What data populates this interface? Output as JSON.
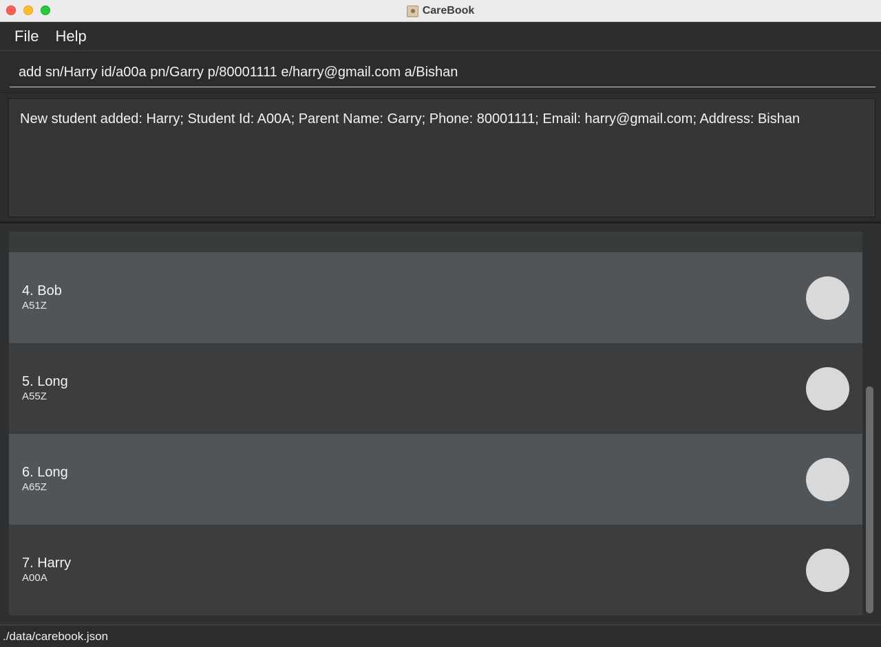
{
  "window": {
    "title": "CareBook"
  },
  "menu": {
    "items": [
      "File",
      "Help"
    ]
  },
  "command": {
    "value": "add sn/Harry id/a00a pn/Garry p/80001111 e/harry@gmail.com a/Bishan"
  },
  "result": {
    "text": "New student added: Harry; Student Id: A00A; Parent Name: Garry; Phone: 80001111; Email: harry@gmail.com; Address: Bishan"
  },
  "students": [
    {
      "title": "4. Bob",
      "id": "A51Z"
    },
    {
      "title": "5. Long",
      "id": "A55Z"
    },
    {
      "title": "6. Long",
      "id": "A65Z"
    },
    {
      "title": "7. Harry",
      "id": "A00A"
    }
  ],
  "status": {
    "path": "./data/carebook.json"
  },
  "colors": {
    "traffic_close": "#fe5f57",
    "traffic_minimize": "#febc2e",
    "traffic_maximize": "#28c840",
    "card_light": "#4f5558",
    "card_dark": "#3b3d3e",
    "avatar": "#d9d9d9"
  }
}
